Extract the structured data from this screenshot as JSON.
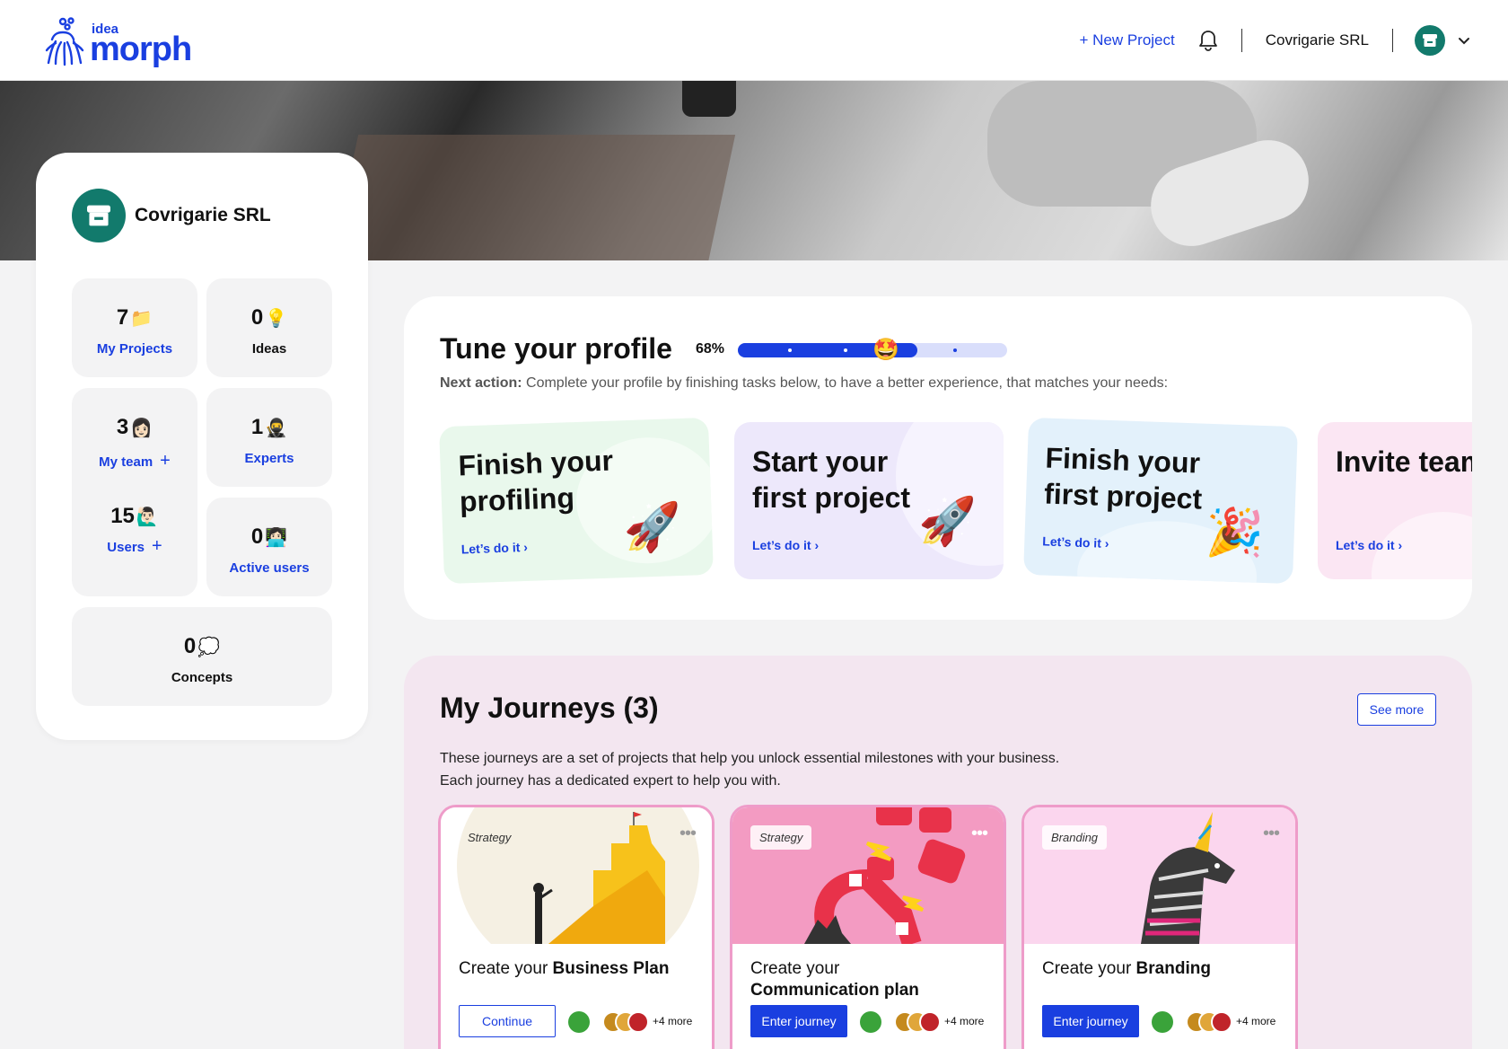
{
  "header": {
    "logo_small": "idea",
    "logo_big": "morph",
    "new_project": "+ New Project",
    "company": "Covrigarie SRL"
  },
  "company_card": {
    "name": "Covrigarie SRL",
    "stats": [
      {
        "value": "7",
        "emoji": "📁",
        "label": "My Projects"
      },
      {
        "value": "0",
        "emoji": "💡",
        "label": "Ideas"
      },
      {
        "value": "3",
        "emoji": "👩🏻",
        "label": "My team"
      },
      {
        "value": "1",
        "emoji": "🥷",
        "label": "Experts"
      },
      {
        "value": "15",
        "emoji": "🙋🏻‍♂️",
        "label": "Users"
      },
      {
        "value": "0",
        "emoji": "👩🏻‍💻",
        "label": "Active users"
      },
      {
        "value": "0",
        "emoji": "💭",
        "label": "Concepts"
      }
    ]
  },
  "tune_profile": {
    "title": "Tune your profile",
    "percent_label": "68%",
    "progress": 0.68,
    "progress_emoji": "🤩",
    "next_action_label": "Next action:",
    "next_action_text": " Complete your profile by finishing tasks below, to have a better experience, that matches your needs:",
    "tasks": [
      {
        "title_line1": "Finish your",
        "title_line2": "profiling",
        "link": "Let’s do it",
        "emoji": "🚀",
        "bg": "#e9f8ec"
      },
      {
        "title_line1": "Start your",
        "title_line2": "first project",
        "link": "Let’s do it",
        "emoji": "🚀",
        "bg": "#ede8fb"
      },
      {
        "title_line1": "Finish your",
        "title_line2": "first project",
        "link": "Let’s do it",
        "emoji": "🎉",
        "bg": "#e3f1fb"
      },
      {
        "title_line1": "Invite team",
        "title_line2": "",
        "link": "Let’s do it",
        "emoji": "",
        "bg": "#fbe6f3"
      }
    ]
  },
  "journeys": {
    "title": "My Journeys (3)",
    "see_more": "See more",
    "desc_line1": "These journeys are a set of projects that help you unlock essential milestones with your business.",
    "desc_line2": "Each journey has a dedicated expert to help you with.",
    "cards": [
      {
        "tag": "Strategy",
        "text_prefix": "Create your ",
        "text_bold": "Business Plan",
        "button": "Continue",
        "more": "+4 more"
      },
      {
        "tag": "Strategy",
        "text_prefix": "Create your",
        "text_bold": "Communication plan",
        "button": "Enter journey",
        "more": "+4 more"
      },
      {
        "tag": "Branding",
        "text_prefix": "Create your ",
        "text_bold": "Branding",
        "button": "Enter journey",
        "more": "+4 more"
      }
    ]
  },
  "colors": {
    "accent": "#1a3fe0",
    "brand_teal": "#127a6c",
    "journey_border": "#ee9cc9"
  },
  "icons": [
    "logo-mark-icon",
    "bell-icon",
    "chevron-down-icon",
    "shop-icon",
    "chevron-right-icon",
    "more-dots-icon",
    "plus-icon"
  ]
}
